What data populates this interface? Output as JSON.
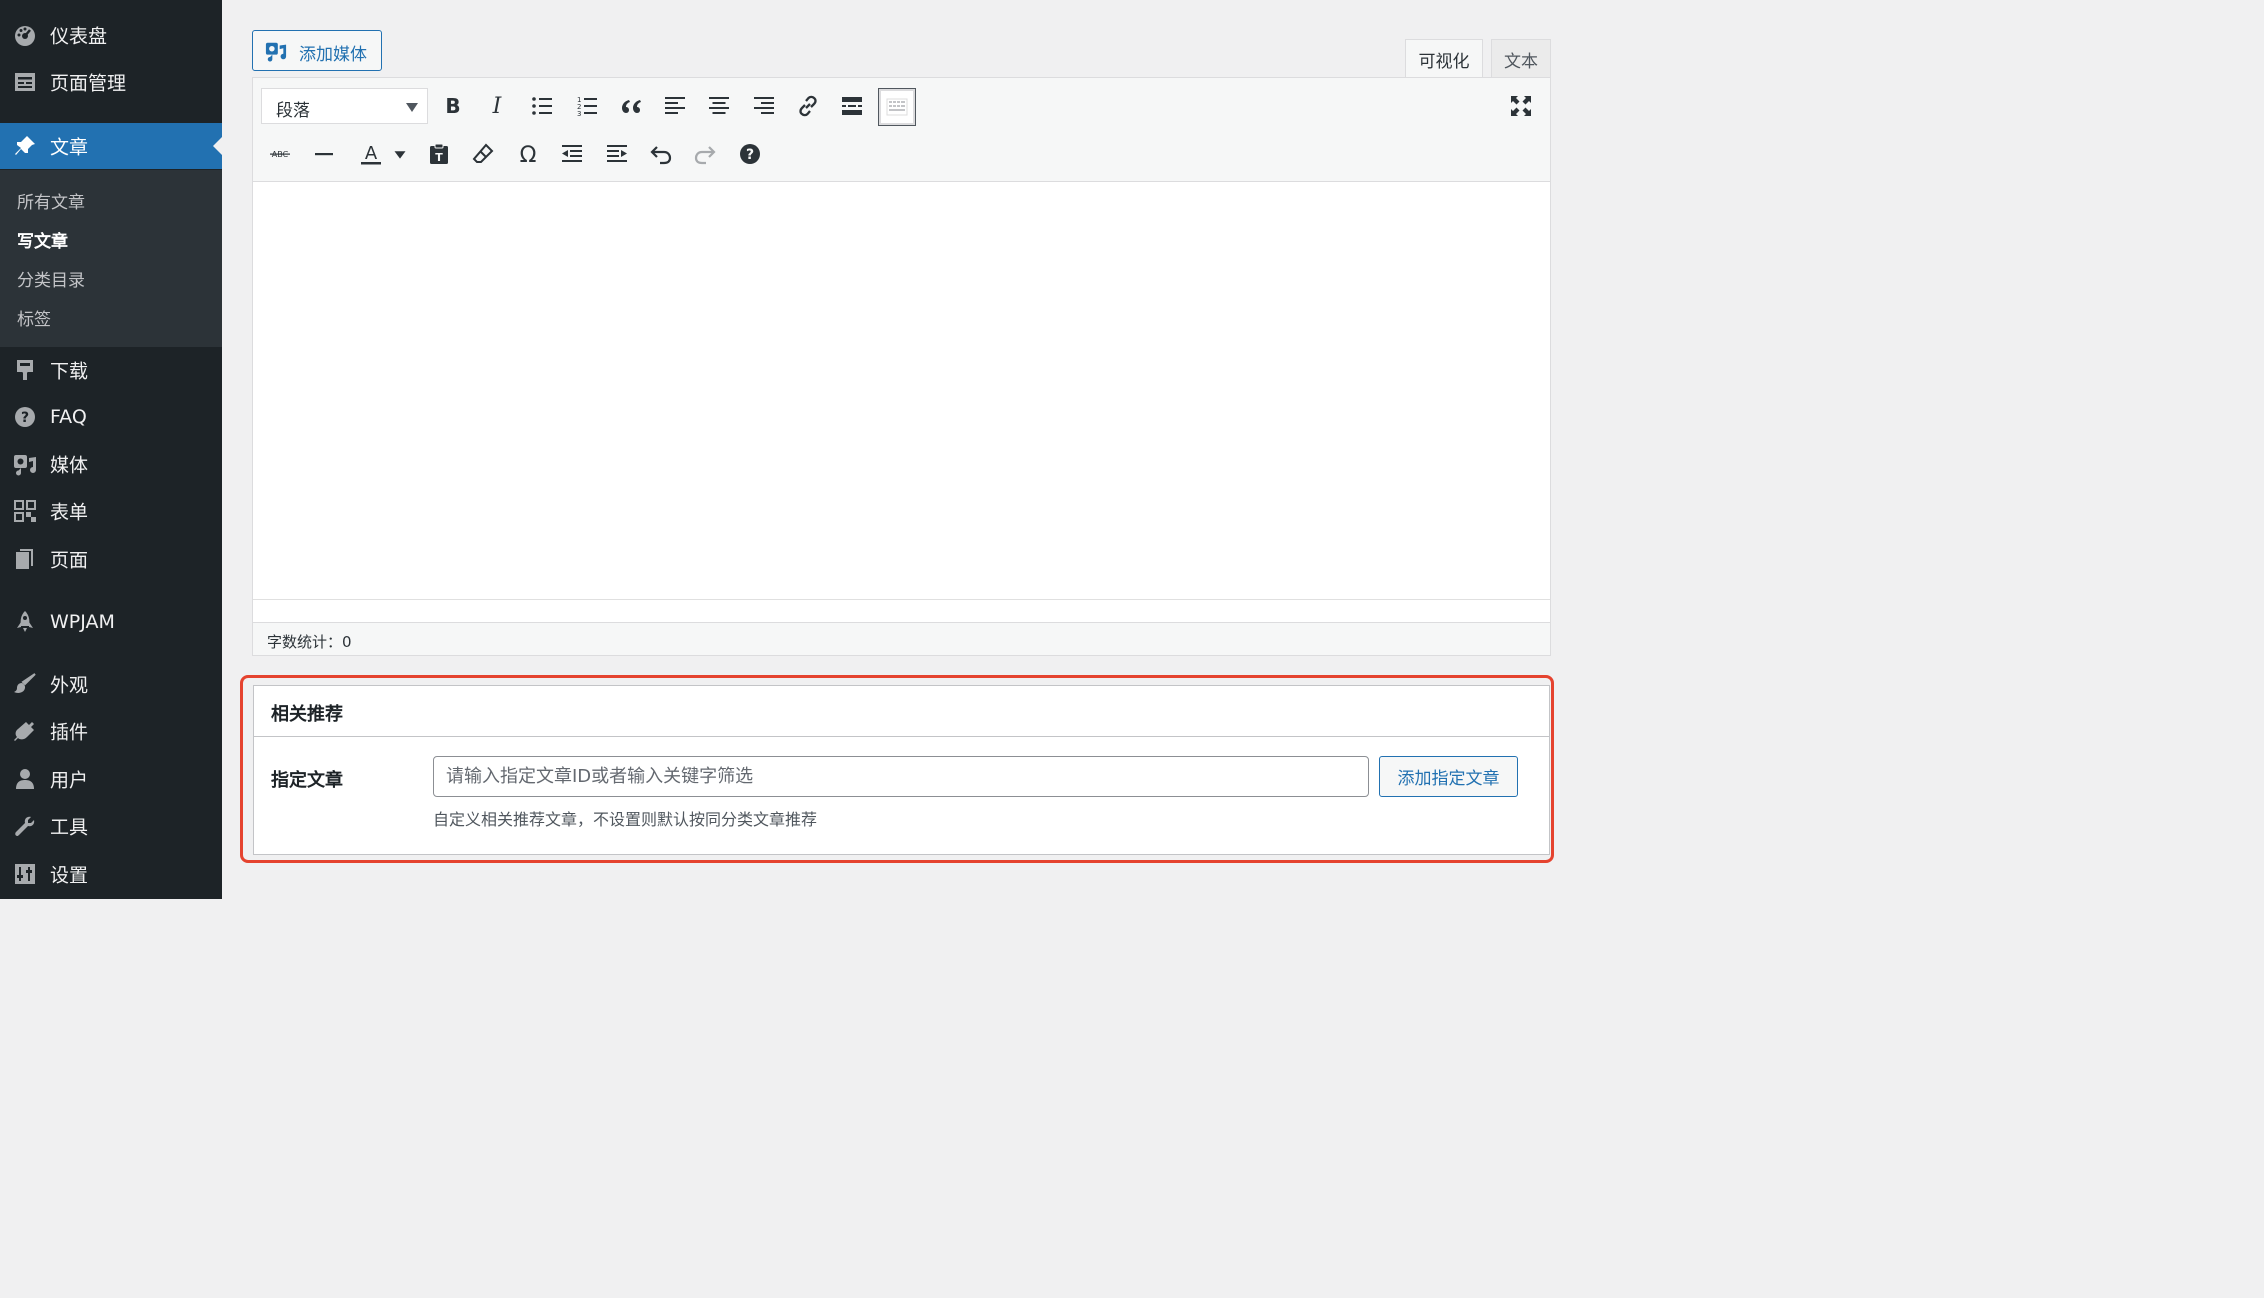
{
  "sidebar": {
    "items": [
      {
        "label": "仪表盘",
        "icon": "dashboard-icon"
      },
      {
        "label": "页面管理",
        "icon": "page-manage-icon"
      },
      {
        "label": "文章",
        "icon": "pin-icon"
      },
      {
        "label": "下载",
        "icon": "download-icon"
      },
      {
        "label": "FAQ",
        "icon": "help-icon"
      },
      {
        "label": "媒体",
        "icon": "media-icon"
      },
      {
        "label": "表单",
        "icon": "form-icon"
      },
      {
        "label": "页面",
        "icon": "pages-icon"
      },
      {
        "label": "WPJAM",
        "icon": "rocket-icon"
      },
      {
        "label": "外观",
        "icon": "appearance-icon"
      },
      {
        "label": "插件",
        "icon": "plugins-icon"
      },
      {
        "label": "用户",
        "icon": "users-icon"
      },
      {
        "label": "工具",
        "icon": "tools-icon"
      },
      {
        "label": "设置",
        "icon": "settings-icon"
      }
    ],
    "submenu": [
      "所有文章",
      "写文章",
      "分类目录",
      "标签"
    ],
    "current_submenu": "写文章"
  },
  "editor": {
    "add_media": "添加媒体",
    "tabs": {
      "visual": "可视化",
      "text": "文本"
    },
    "format_select": "段落",
    "word_count": "字数统计：0"
  },
  "metabox": {
    "title": "相关推荐",
    "field_label": "指定文章",
    "search_placeholder": "请输入指定文章ID或者输入关键字筛选",
    "add_button": "添加指定文章",
    "description": "自定义相关推荐文章，不设置则默认按同分类文章推荐"
  },
  "colors": {
    "sidebar_bg": "#1d2327",
    "submenu_bg": "#2c3338",
    "accent": "#2271b1",
    "highlight_border": "#e5432f"
  }
}
